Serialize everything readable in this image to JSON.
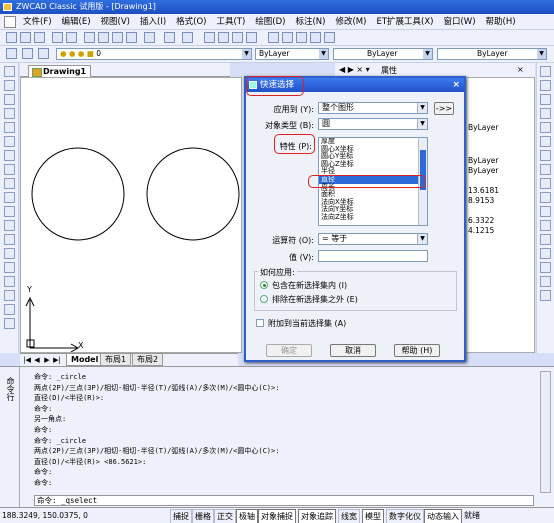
{
  "app": {
    "title": "ZWCAD Classic 试用版 - [Drawing1]"
  },
  "menu": [
    "文件(F)",
    "编辑(E)",
    "视图(V)",
    "插入(I)",
    "格式(O)",
    "工具(T)",
    "绘图(D)",
    "标注(N)",
    "修改(M)",
    "ET扩展工具(X)",
    "窗口(W)",
    "帮助(H)"
  ],
  "toolbar": {
    "layer_value": "0",
    "color_value": "ByLayer",
    "linetype_value": "ByLayer",
    "lineweight_value": "ByLayer"
  },
  "drawing": {
    "tab": "Drawing1",
    "axis_x": "X",
    "axis_y": "Y"
  },
  "layout_tabs": [
    "Model",
    "布局1",
    "布局2"
  ],
  "properties_panel": {
    "title": "属性",
    "values": [
      "ByLayer",
      "ByLayer",
      "ByLayer",
      "13.6181",
      "8.9153",
      "6.3322",
      "4.1215"
    ]
  },
  "dialog": {
    "title": "快速选择",
    "apply_to_label": "应用到 (Y):",
    "apply_to_value": "整个图形",
    "object_type_label": "对象类型 (B):",
    "object_type_value": "圆",
    "properties_label": "特性 (P):",
    "properties_list": [
      "厚度",
      "圆心X坐标",
      "圆心Y坐标",
      "圆心Z坐标",
      "半径",
      "直径",
      "周长",
      "面积",
      "法向X坐标",
      "法向Y坐标",
      "法向Z坐标"
    ],
    "selected_property": "直径",
    "operator_label": "运算符 (O):",
    "operator_value": "= 等于",
    "value_label": "值 (V):",
    "value_value": "",
    "how_apply_label": "如何应用:",
    "radio_include": "包含在新选择集内 (I)",
    "radio_exclude": "排除在新选择集之外 (E)",
    "append_label": "附加到当前选择集 (A)",
    "ok": "确定",
    "cancel": "取消",
    "help": "帮助 (H)",
    "select_objects_button": "->>"
  },
  "command_window": {
    "side_label": "命令行",
    "lines": [
      "命令: _circle",
      "两点(2P)/三点(3P)/相切-相切-半径(T)/弧线(A)/多次(M)/<圆中心(C)>:",
      "直径(D)/<半径(R)>:",
      "命令:",
      "另一角点:",
      "命令:",
      "命令: _circle",
      "两点(2P)/三点(3P)/相切-相切-半径(T)/弧线(A)/多次(M)/<圆中心(C)>:",
      "直径(D)/<半径(R)> <86.5621>:",
      "命令:",
      "命令:",
      "命令: _qselect"
    ],
    "input": "命令: _qselect"
  },
  "status": {
    "coords": "188.3249, 150.0375, 0",
    "toggles": [
      "捕捉",
      "栅格",
      "正交",
      "极轴",
      "对象捕捉",
      "对象追踪",
      "线宽",
      "模型",
      "数字化仪",
      "动态输入",
      "就绪"
    ]
  }
}
